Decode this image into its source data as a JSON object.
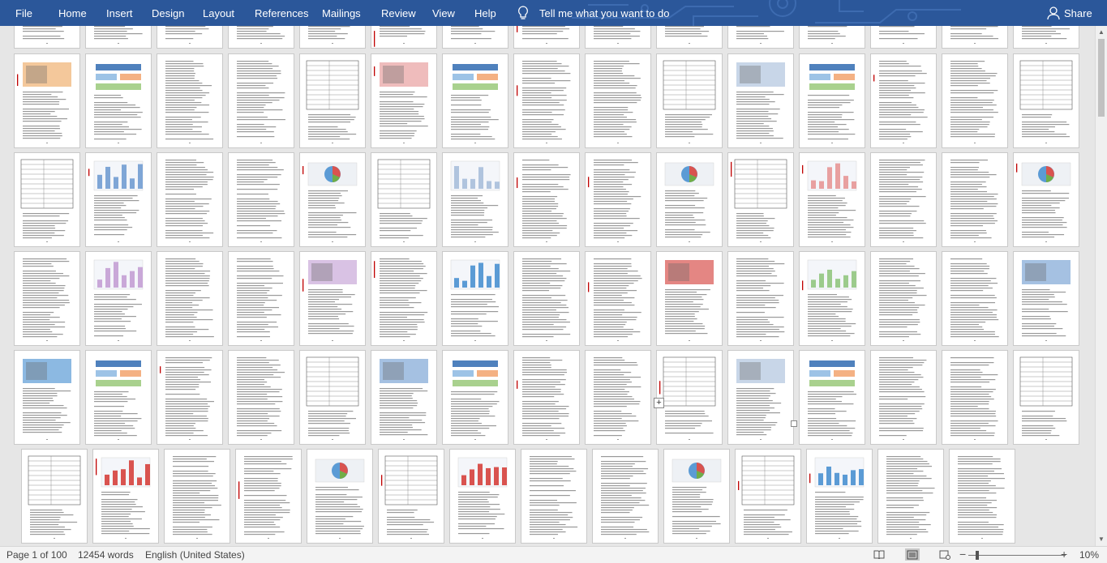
{
  "ribbon": {
    "tabs": [
      "File",
      "Home",
      "Insert",
      "Design",
      "Layout",
      "References",
      "Mailings",
      "Review",
      "View",
      "Help"
    ],
    "tell_me": "Tell me what you want to do",
    "share": "Share",
    "bg_color": "#2b579a"
  },
  "status_bar": {
    "page_info": "Page 1 of 100",
    "word_count": "12454 words",
    "language": "English (United States)",
    "zoom": "10%",
    "zoom_minus": "−",
    "zoom_plus": "+"
  },
  "document": {
    "total_pages": 100,
    "visible_pages": 82
  }
}
